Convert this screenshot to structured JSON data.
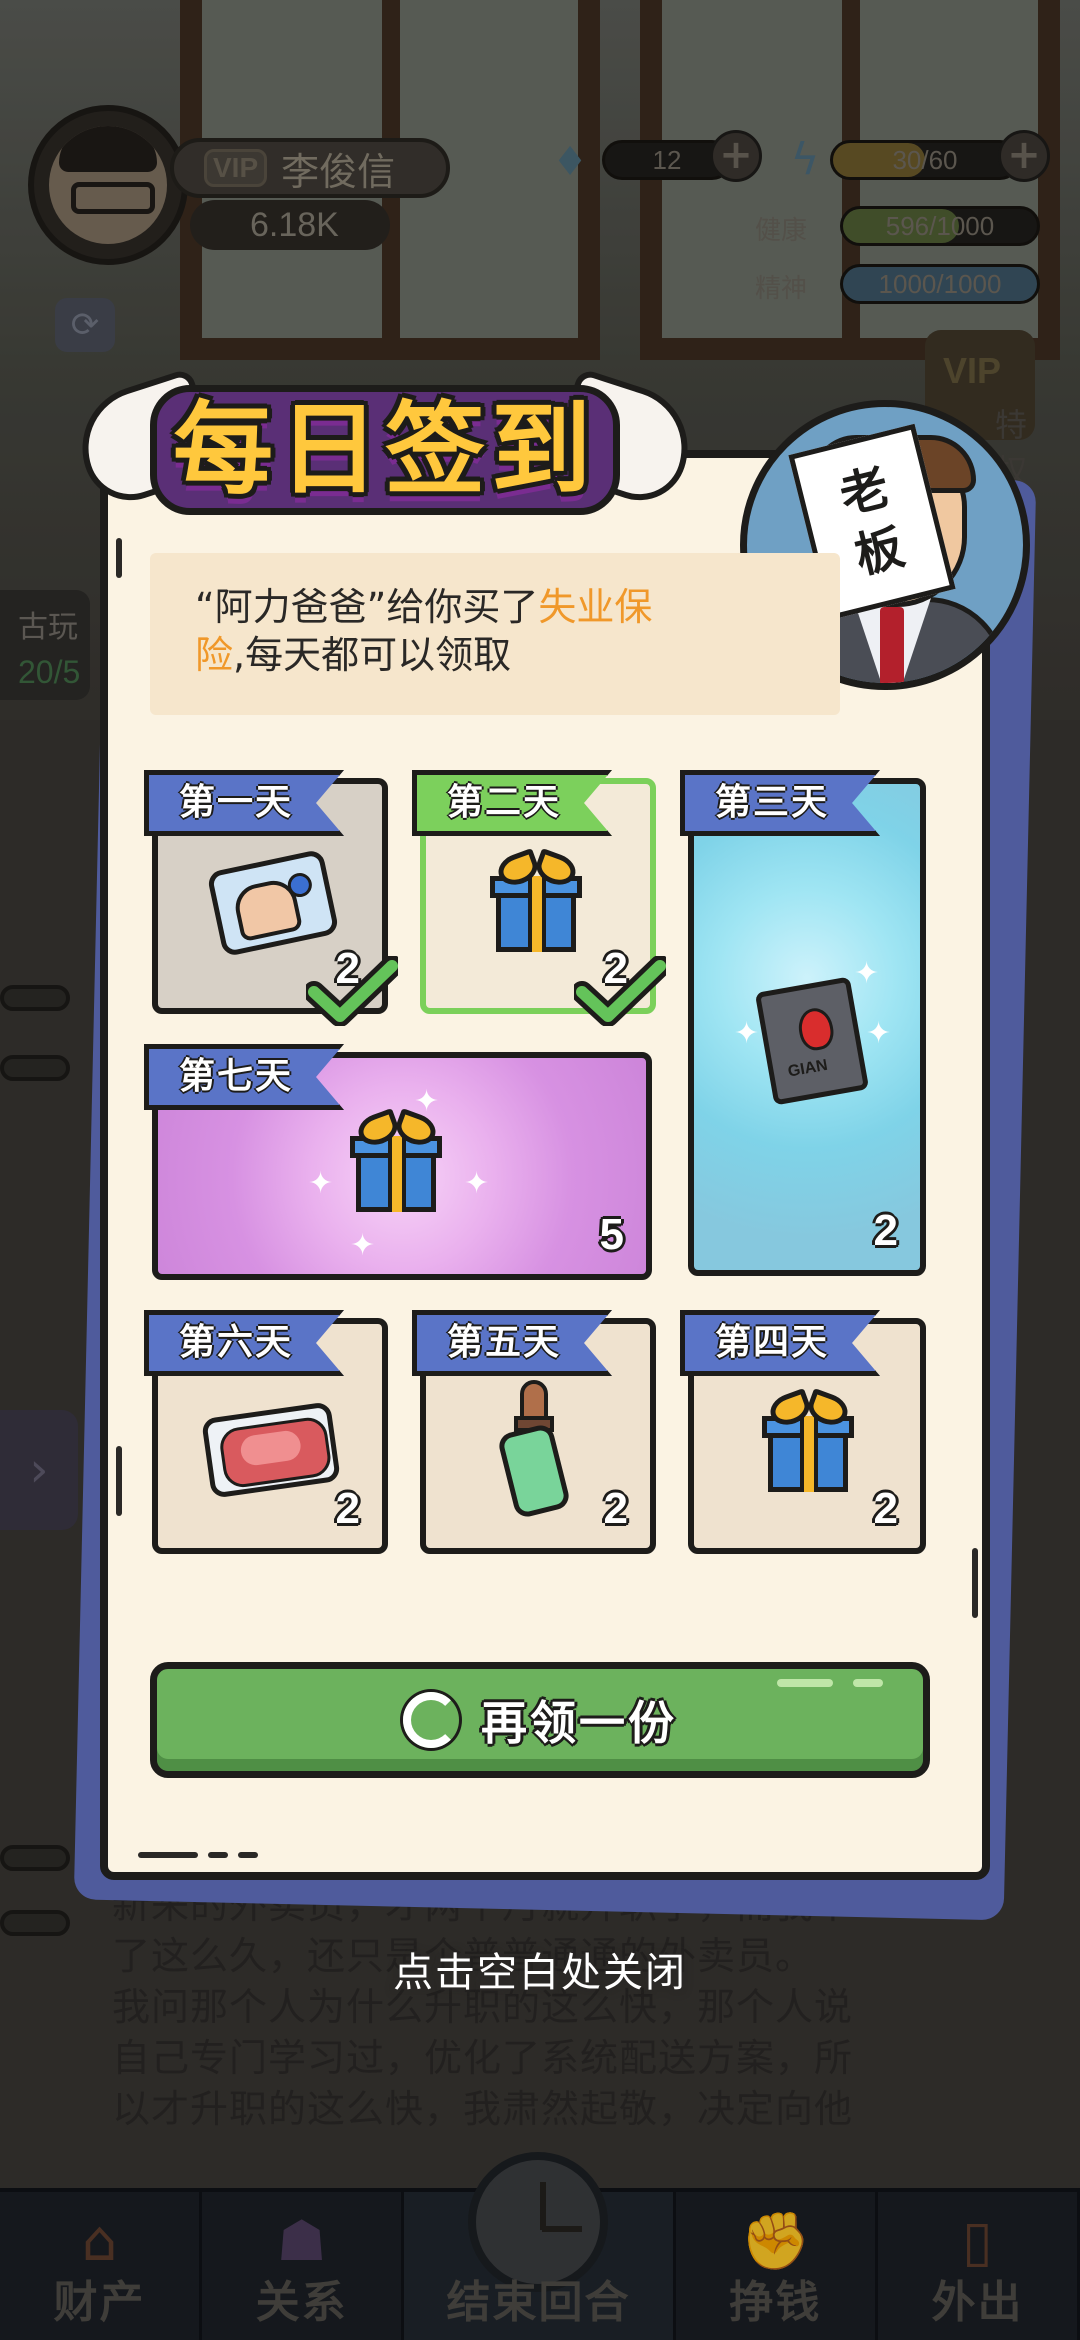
{
  "player": {
    "vip_label": "VIP",
    "name": "李俊信",
    "money": "6.18K"
  },
  "resources": {
    "gems": "12",
    "energy": "30/60",
    "energy_fraction": 0.5,
    "health_label": "健康",
    "health": "596/1000",
    "health_fraction": 0.596,
    "mind_label": "精神",
    "mind": "1000/1000",
    "mind_fraction": 1.0
  },
  "background": {
    "vip_privilege": "VIP",
    "vip_privilege_suffix": "特权",
    "side_label": "古玩",
    "side_value": "20/5",
    "story_lines": [
      "新来的外卖员，才两个月就升职了，而我干",
      "了这么久，还只是个普普通通的外卖员。",
      "我问那个人为什么升职的这么快，那个人说",
      "自己专门学习过，优化了系统配送方案，所",
      "以才升职的这么快，我肃然起敬，决定向他"
    ]
  },
  "dialog": {
    "title": "每日签到",
    "boss_note": [
      "老",
      "板"
    ],
    "notice_part1": "“阿力爸爸”给你买了",
    "notice_highlight1": "失业保",
    "notice_highlight2": "险",
    "notice_part2": ",每天都可以领取",
    "days": [
      {
        "label": "第一天",
        "qty": "2",
        "item": "fitness-card-icon",
        "claimed": true
      },
      {
        "label": "第二天",
        "qty": "2",
        "item": "gift-box-icon",
        "claimed": true
      },
      {
        "label": "第三天",
        "qty": "2",
        "item": "dark-book-icon",
        "claimed": false
      },
      {
        "label": "第七天",
        "qty": "5",
        "item": "gift-box-icon",
        "claimed": false
      },
      {
        "label": "第六天",
        "qty": "2",
        "item": "meat-tray-icon",
        "claimed": false
      },
      {
        "label": "第五天",
        "qty": "2",
        "item": "dropper-bottle-icon",
        "claimed": false
      },
      {
        "label": "第四天",
        "qty": "2",
        "item": "gift-box-icon",
        "claimed": false
      }
    ],
    "book_text": "GIAN",
    "claim_button": "再领一份",
    "close_hint": "点击空白处关闭"
  },
  "bottom_nav": [
    {
      "label": "财产"
    },
    {
      "label": "关系"
    },
    {
      "label": "结束回合"
    },
    {
      "label": "挣钱"
    },
    {
      "label": "外出"
    }
  ],
  "colors": {
    "title_gold": "#ffc83d",
    "ribbon_blue": "#5a74c7",
    "ribbon_green": "#7cd05c",
    "claim_green": "#6cb25d",
    "highlight_orange": "#f0982a"
  }
}
